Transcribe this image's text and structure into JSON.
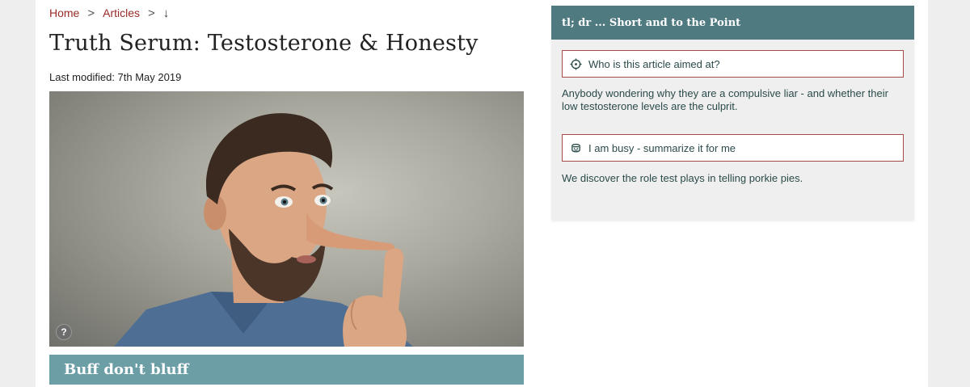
{
  "breadcrumb": {
    "home": "Home",
    "articles": "Articles",
    "separator": ">",
    "current": "↓"
  },
  "article": {
    "title": "Truth Serum: Testosterone & Honesty",
    "last_modified": "Last modified: 7th May 2019",
    "image_help": "?",
    "section_heading": "Buff don't bluff"
  },
  "tldr": {
    "header": "tl; dr ... Short and to the Point",
    "audience_button": "Who is this article aimed at?",
    "audience_text": "Anybody wondering why they are a compulsive liar - and whether their low testosterone levels are the culprit.",
    "summary_button": "I am busy - summarize it for me",
    "summary_text": "We discover the role test plays in telling porkie pies."
  },
  "colors": {
    "link": "#9a2a26",
    "tldr_header_bg": "#4f7a80",
    "section_bar_bg": "#6c9ea6",
    "button_border": "#a64a4a"
  }
}
